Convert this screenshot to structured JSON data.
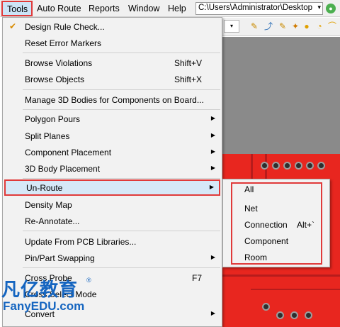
{
  "menubar": {
    "items": [
      "Tools",
      "Auto Route",
      "Reports",
      "Window",
      "Help"
    ],
    "path": "C:\\Users\\Administrator\\Desktop",
    "path_arrow": "▾",
    "go_glyph": "●"
  },
  "toolbar": {
    "drop_glyph": "▾",
    "icons": [
      "✎",
      "⤴",
      "✎",
      "✦",
      "●",
      "◔",
      "⌒"
    ]
  },
  "menu": {
    "items": [
      {
        "label": "Design Rule Check...",
        "shortcut": "",
        "submenu": false,
        "icon": "✔"
      },
      {
        "label": "Reset Error Markers",
        "shortcut": "",
        "submenu": false
      },
      {
        "label": "Browse Violations",
        "shortcut": "Shift+V",
        "submenu": false
      },
      {
        "label": "Browse Objects",
        "shortcut": "Shift+X",
        "submenu": false
      },
      {
        "label": "Manage 3D Bodies for Components on Board...",
        "shortcut": "",
        "submenu": false
      },
      {
        "label": "Polygon Pours",
        "shortcut": "",
        "submenu": true
      },
      {
        "label": "Split Planes",
        "shortcut": "",
        "submenu": true
      },
      {
        "label": "Component Placement",
        "shortcut": "",
        "submenu": true
      },
      {
        "label": "3D Body Placement",
        "shortcut": "",
        "submenu": true
      },
      {
        "label": "Un-Route",
        "shortcut": "",
        "submenu": true
      },
      {
        "label": "Density Map",
        "shortcut": "",
        "submenu": false
      },
      {
        "label": "Re-Annotate...",
        "shortcut": "",
        "submenu": false
      },
      {
        "label": "Update From PCB Libraries...",
        "shortcut": "",
        "submenu": false
      },
      {
        "label": "Pin/Part Swapping",
        "shortcut": "",
        "submenu": true
      },
      {
        "label": "Cross Probe",
        "shortcut": "F7",
        "submenu": false
      },
      {
        "label": "Cross Select Mode",
        "shortcut": "",
        "submenu": false
      },
      {
        "label": "Convert",
        "shortcut": "",
        "submenu": true
      }
    ],
    "arrow_glyph": "▶"
  },
  "submenu": {
    "items": [
      {
        "label": "All",
        "shortcut": ""
      },
      {
        "label": "Net",
        "shortcut": ""
      },
      {
        "label": "Connection",
        "shortcut": "Alt+`"
      },
      {
        "label": "Component",
        "shortcut": ""
      },
      {
        "label": "Room",
        "shortcut": ""
      }
    ]
  },
  "watermark": {
    "chinese": "凡亿教育",
    "registered": "®",
    "english": "FanyEDU.com"
  },
  "colors": {
    "highlight_border": "#e03a3a",
    "menu_bg": "#f2f2f2",
    "pcb_red": "#e8261f",
    "watermark_blue": "#1565c0"
  }
}
